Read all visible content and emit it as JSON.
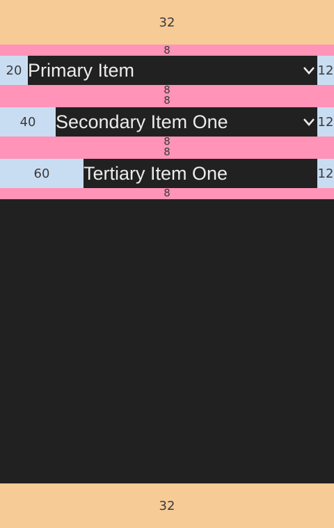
{
  "top_band": {
    "label": "32"
  },
  "bottom_band": {
    "label": "32"
  },
  "spacers": [
    "8",
    "8",
    "8",
    "8",
    "8",
    "8"
  ],
  "rows": [
    {
      "label": "Primary Item",
      "indent": "20",
      "trailing": "12",
      "expandable": true,
      "expand_icon": "chevron-down-icon"
    },
    {
      "label": "Secondary Item One",
      "indent": "40",
      "trailing": "12",
      "expandable": true,
      "expand_icon": "chevron-down-icon"
    },
    {
      "label": "Tertiary Item One",
      "indent": "60",
      "trailing": "12",
      "expandable": false
    }
  ],
  "colors": {
    "background": "#212121",
    "margin_band": "#f6cb96",
    "spacing_band": "#ff93b8",
    "padding_band": "#c9ddf2",
    "text": "#ececec"
  }
}
